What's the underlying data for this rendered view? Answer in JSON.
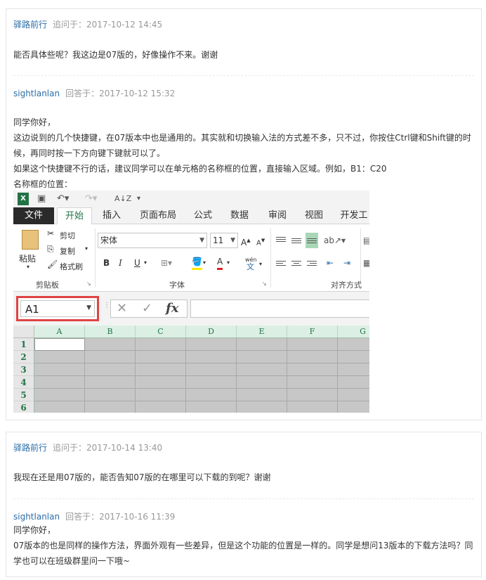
{
  "posts": [
    {
      "user": "驿路前行",
      "label": "追问于：",
      "time": "2017-10-12 14:45",
      "body": "能否具体些呢？我这边是07版的，好像操作不来。谢谢"
    },
    {
      "user": "sightlanlan",
      "label": "回答于：",
      "time": "2017-10-12 15:32",
      "lines": [
        "同学你好，",
        "这边说到的几个快捷键，在07版本中也是通用的。其实就和切换输入法的方式差不多，只不过，你按住Ctrl键和Shift键的时候，再同时按一下方向键下键就可以了。",
        "如果这个快捷键不行的话，建议同学可以在单元格的名称框的位置，直接输入区域。例如，B1：C20",
        "名称框的位置："
      ]
    },
    {
      "user": "驿路前行",
      "label": "追问于：",
      "time": "2017-10-14 13:40",
      "body": "我现在还是用07版的，能否告知07版的在哪里可以下载的到呢？谢谢"
    },
    {
      "user": "sightlanlan",
      "label": "回答于：",
      "time": "2017-10-16 11:39",
      "lines": [
        "同学你好，",
        "07版本的也是同样的操作方法，界面外观有一些差异，但是这个功能的位置是一样的。同学是想问13版本的下载方法吗？同学也可以在班级群里问一下哦~"
      ]
    }
  ],
  "excel": {
    "tabs": [
      "文件",
      "开始",
      "插入",
      "页面布局",
      "公式",
      "数据",
      "审阅",
      "视图",
      "开发工"
    ],
    "clipboard": {
      "paste": "粘贴",
      "cut": "剪切",
      "copy": "复制",
      "format_painter": "格式刷",
      "group": "剪贴板"
    },
    "font": {
      "name": "宋体",
      "size": "11",
      "bold": "B",
      "italic": "I",
      "underline": "U",
      "phonetic": "wén",
      "group": "字体"
    },
    "align": {
      "group": "对齐方式"
    },
    "name_box": "A1",
    "fx": "fx",
    "columns": [
      "A",
      "B",
      "C",
      "D",
      "E",
      "F",
      "G"
    ],
    "rows": [
      "1",
      "2",
      "3",
      "4",
      "5",
      "6"
    ],
    "colors": {
      "accent": "#217346",
      "highlight_border": "#e04343"
    }
  }
}
